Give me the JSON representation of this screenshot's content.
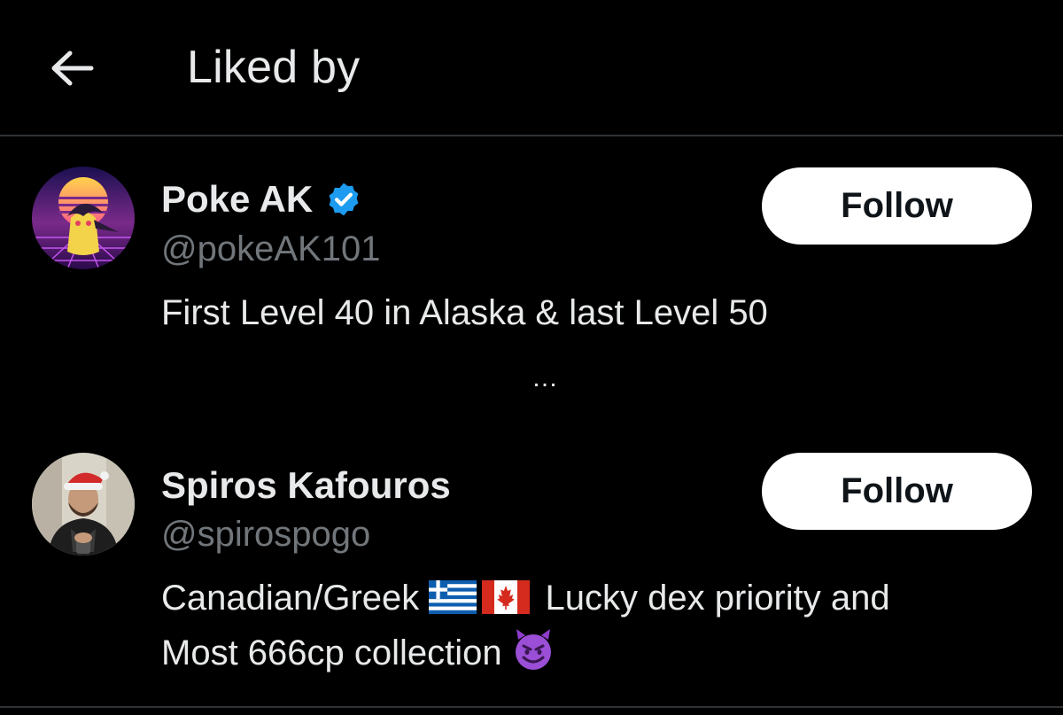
{
  "header": {
    "title": "Liked by",
    "back_icon": "arrow-left-icon"
  },
  "users": [
    {
      "name": "Poke AK",
      "verified": true,
      "handle": "@pokeAK101",
      "bio": "First Level 40 in Alaska & last Level 50",
      "follow_label": "Follow"
    },
    {
      "name": "Spiros Kafouros",
      "verified": false,
      "handle": "@spirospogo",
      "bio_part1": "Canadian/Greek",
      "bio_part2": "Lucky dex priority and",
      "bio_line2": "Most 666cp collection",
      "follow_label": "Follow"
    }
  ],
  "more_indicator": "…",
  "colors": {
    "background": "#000000",
    "text_primary": "#e7e9ea",
    "text_secondary": "#71767b",
    "verified_blue": "#1d9bf0",
    "divider": "#2f3336",
    "button_bg": "#ffffff"
  }
}
